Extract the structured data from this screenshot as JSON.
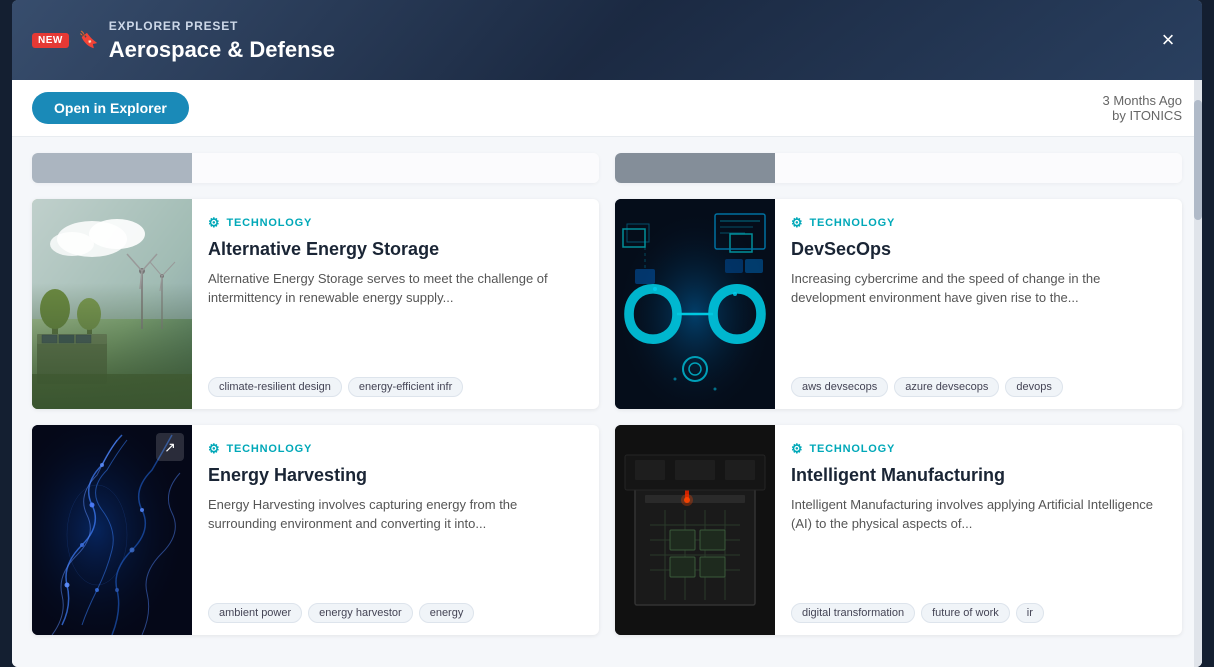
{
  "header": {
    "badge": "NEW",
    "preset_label": "EXPLORER PRESET",
    "title": "Aerospace & Defense",
    "close_label": "×"
  },
  "toolbar": {
    "open_btn_label": "Open in Explorer",
    "meta_time": "3 Months Ago",
    "meta_by": "by ITONICS"
  },
  "top_row": [
    {
      "id": "top-card-1"
    },
    {
      "id": "top-card-2"
    }
  ],
  "cards": [
    {
      "id": "card-energy-storage",
      "category": "TECHNOLOGY",
      "title": "Alternative Energy Storage",
      "description": "Alternative Energy Storage serves to meet the challenge of intermittency in renewable energy supply...",
      "tags": [
        "climate-resilient design",
        "energy-efficient infr"
      ],
      "image_type": "energy-storage"
    },
    {
      "id": "card-devsecops",
      "category": "TECHNOLOGY",
      "title": "DevSecOps",
      "description": "Increasing cybercrime and the speed of change in the development environment have given rise to the...",
      "tags": [
        "aws devsecops",
        "azure devsecops",
        "devops"
      ],
      "image_type": "devsecops"
    },
    {
      "id": "card-energy-harvesting",
      "category": "TECHNOLOGY",
      "title": "Energy Harvesting",
      "description": "Energy Harvesting involves capturing energy from the surrounding environment and converting it into...",
      "tags": [
        "ambient power",
        "energy harvestor",
        "energy"
      ],
      "image_type": "energy-harvesting",
      "has_expand": true
    },
    {
      "id": "card-intelligent-manufacturing",
      "category": "TECHNOLOGY",
      "title": "Intelligent Manufacturing",
      "description": "Intelligent Manufacturing involves applying Artificial Intelligence (AI) to the physical aspects of...",
      "tags": [
        "digital transformation",
        "future of work",
        "ir"
      ],
      "image_type": "manufacturing"
    }
  ]
}
